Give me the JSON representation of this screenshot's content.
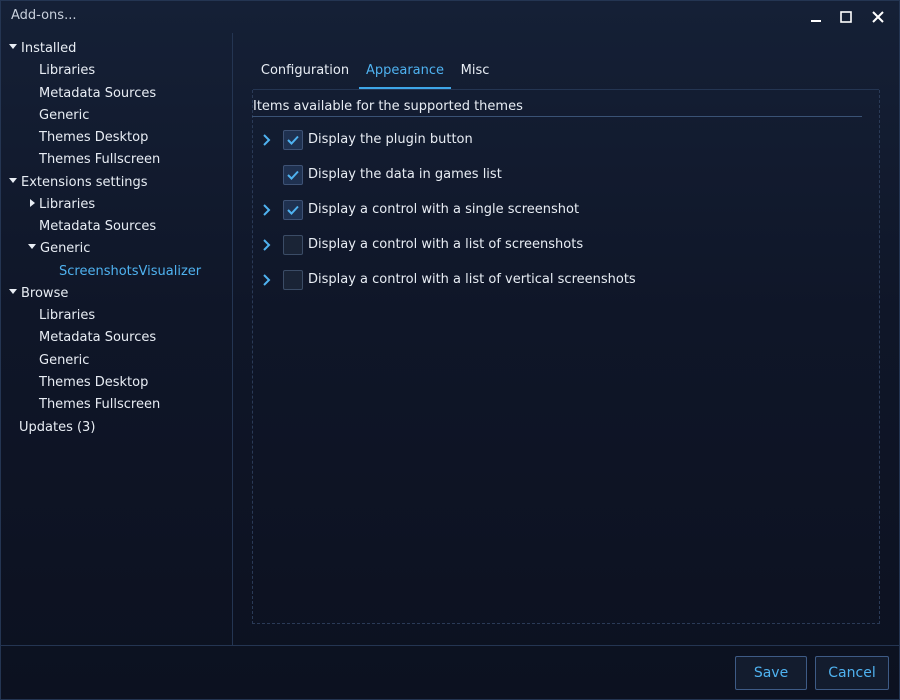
{
  "window": {
    "title": "Add-ons...",
    "controls": [
      "minimize-icon",
      "maximize-icon",
      "close-icon"
    ]
  },
  "sidebar": {
    "items": [
      {
        "label": "Installed",
        "level": 0,
        "expander": "expanded"
      },
      {
        "label": "Libraries",
        "level": 1
      },
      {
        "label": "Metadata Sources",
        "level": 1
      },
      {
        "label": "Generic",
        "level": 1
      },
      {
        "label": "Themes Desktop",
        "level": 1
      },
      {
        "label": "Themes Fullscreen",
        "level": 1
      },
      {
        "label": "Extensions settings",
        "level": 0,
        "expander": "expanded"
      },
      {
        "label": "Libraries",
        "level": 1,
        "expander": "collapsed"
      },
      {
        "label": "Metadata Sources",
        "level": 1
      },
      {
        "label": "Generic",
        "level": 1,
        "expander": "expanded"
      },
      {
        "label": "ScreenshotsVisualizer",
        "level": 2,
        "selected": true
      },
      {
        "label": "Browse",
        "level": 0,
        "expander": "expanded"
      },
      {
        "label": "Libraries",
        "level": 1
      },
      {
        "label": "Metadata Sources",
        "level": 1
      },
      {
        "label": "Generic",
        "level": 1
      },
      {
        "label": "Themes Desktop",
        "level": 1
      },
      {
        "label": "Themes Fullscreen",
        "level": 1
      },
      {
        "label": "Updates (3)",
        "level": 0
      }
    ]
  },
  "tabs": [
    {
      "label": "Configuration",
      "active": false
    },
    {
      "label": "Appearance",
      "active": true
    },
    {
      "label": "Misc",
      "active": false
    }
  ],
  "appearance": {
    "header": "Items available for the supported themes",
    "items": [
      {
        "label": "Display the plugin button",
        "checked": true,
        "expandable": true
      },
      {
        "label": "Display the data in games list",
        "checked": true,
        "expandable": false
      },
      {
        "label": "Display a control with a single screenshot",
        "checked": true,
        "expandable": true
      },
      {
        "label": "Display a control with a list of screenshots",
        "checked": false,
        "expandable": true
      },
      {
        "label": "Display a control with a list of vertical screenshots",
        "checked": false,
        "expandable": true
      }
    ]
  },
  "footer": {
    "save_label": "Save",
    "cancel_label": "Cancel"
  },
  "colors": {
    "accent": "#4fb2f0",
    "background": "#0e1321",
    "border": "#243552"
  }
}
